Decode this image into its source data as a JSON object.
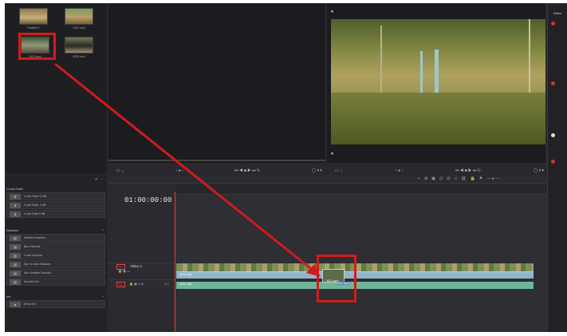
{
  "media_pool": {
    "clips": [
      {
        "name": "Timeline 1",
        "icon": "timeline-icon"
      },
      {
        "name": "VID1.mp4",
        "icon": "video-clip-icon"
      },
      {
        "name": "VID2.mp4",
        "icon": "video-clip-icon"
      },
      {
        "name": "VID3.mp4",
        "icon": "video-clip-icon"
      }
    ]
  },
  "effects": {
    "cross_fade_title": "Cross Fade",
    "cross_fade_items": [
      "Cross Fade +3 dB",
      "Cross Fade -3 dB",
      "Cross Fade 0 dB"
    ],
    "dissolve_title": "Dissolve",
    "dissolve_items": [
      "Additive Dissolve",
      "Blur Dissolve",
      "Cross Dissolve",
      "Dip To Color Dissolve",
      "Non-Additive Dissolve",
      "Smooth Cut"
    ],
    "iris_title": "Iris",
    "iris_items": [
      "Arrow Iris"
    ]
  },
  "timeline": {
    "timecode": "01:00:00:00",
    "video_track_tag": "V1",
    "video_track_name": "Video 1",
    "audio_track_tag": "A1",
    "audio_track_channels": "2.0",
    "clip_video_label": "VID1.mp4",
    "clip_audio_label": "VID1.mp4",
    "dragged_clip_label": "VID2.mp4",
    "dragged_audio_label": "VID2.mp4"
  },
  "inspector": {
    "label": "Video"
  },
  "colors": {
    "annotation": "#d21b1b",
    "video_clip": "#7e8f5a",
    "audio_clip": "#8fb7c9",
    "playhead": "#dd4433"
  }
}
